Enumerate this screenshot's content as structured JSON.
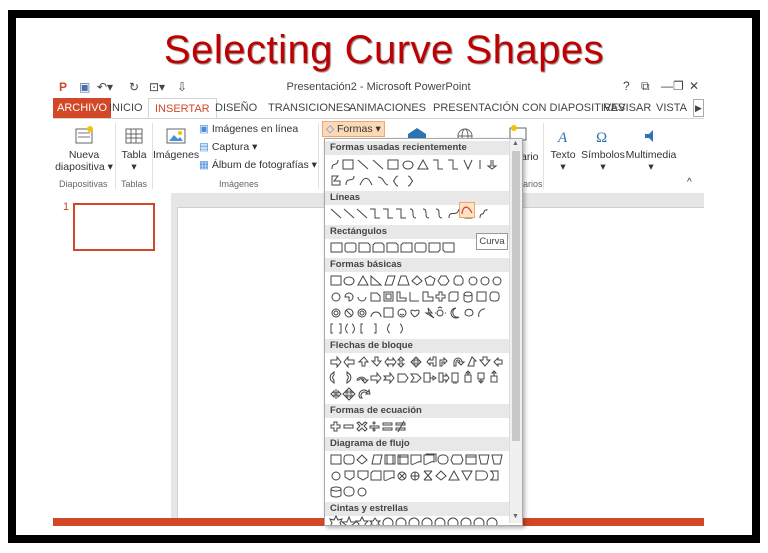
{
  "slide_title": "Selecting Curve Shapes",
  "window": {
    "title": "Presentación2 - Microsoft PowerPoint",
    "help": "?",
    "controls": [
      "⧉",
      "—",
      "❐",
      "✕"
    ]
  },
  "tabs": [
    {
      "label": "ARCHIVO"
    },
    {
      "label": "INICIO"
    },
    {
      "label": "INSERTAR"
    },
    {
      "label": "DISEÑO"
    },
    {
      "label": "TRANSICIONES"
    },
    {
      "label": "ANIMACIONES"
    },
    {
      "label": "PRESENTACIÓN CON DIAPOSITIVAS"
    },
    {
      "label": "REVISAR"
    },
    {
      "label": "VISTA"
    }
  ],
  "ribbon": {
    "nueva_1": "Nueva",
    "nueva_2": "diapositiva ▾",
    "tabla": "Tabla",
    "tabla_arrow": "▾",
    "imagenes": "Imágenes",
    "imagenes_linea": "Imágenes en línea",
    "captura": "Captura ▾",
    "album": "Álbum de fotografías ▾",
    "formas": "Formas ▾",
    "comentario_partial": "ario",
    "texto": "Texto",
    "simbolos": "Símbolos",
    "multimedia": "Multimedia",
    "group_diapositivas": "Diapositivas",
    "group_tablas": "Tablas",
    "group_imagenes": "Imágenes",
    "group_comentarios_partial": "arios",
    "collapse": "^"
  },
  "thumbnail_number": "1",
  "shapes_menu": {
    "sections": [
      "Formas usadas recientemente",
      "Líneas",
      "Rectángulos",
      "Formas básicas",
      "Flechas de bloque",
      "Formas de ecuación",
      "Diagrama de flujo",
      "Cintas y estrellas"
    ],
    "tooltip": "Curva"
  },
  "colors": {
    "accent": "#d24726",
    "title_red": "#c00000"
  }
}
